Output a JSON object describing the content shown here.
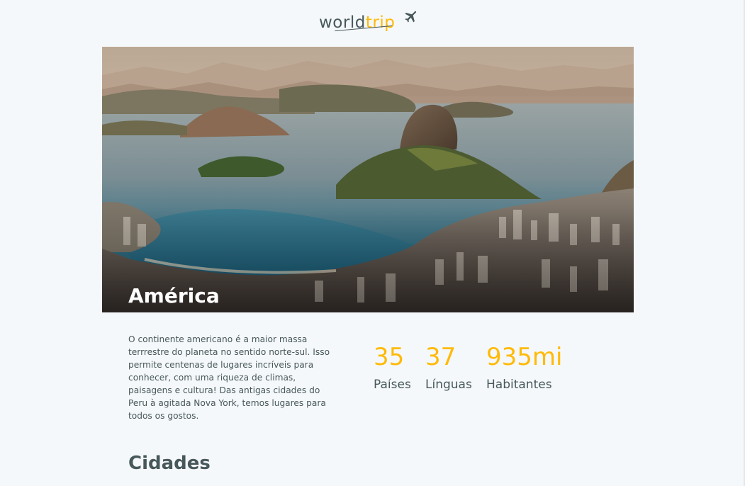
{
  "header": {
    "logo": {
      "part1": "world",
      "part2": "trip",
      "icon": "airplane-icon"
    }
  },
  "banner": {
    "title": "América",
    "image": "rio-de-janeiro-landscape"
  },
  "info": {
    "description": "O continente americano é a maior massa terrrestre do planeta no sentido norte-sul. Isso permite centenas de lugares incríveis para conhecer, com uma riqueza de climas, paisagens e cultura! Das antigas cidades do Peru à agitada Nova York, temos lugares para todos os gostos.",
    "stats": [
      {
        "value": "35",
        "label": "Países"
      },
      {
        "value": "37",
        "label": "Línguas"
      },
      {
        "value": "935mi",
        "label": "Habitantes"
      }
    ]
  },
  "cities": {
    "title": "Cidades"
  },
  "colors": {
    "accent": "#ffba08",
    "text": "#47585b",
    "background": "#f5f8fa"
  }
}
